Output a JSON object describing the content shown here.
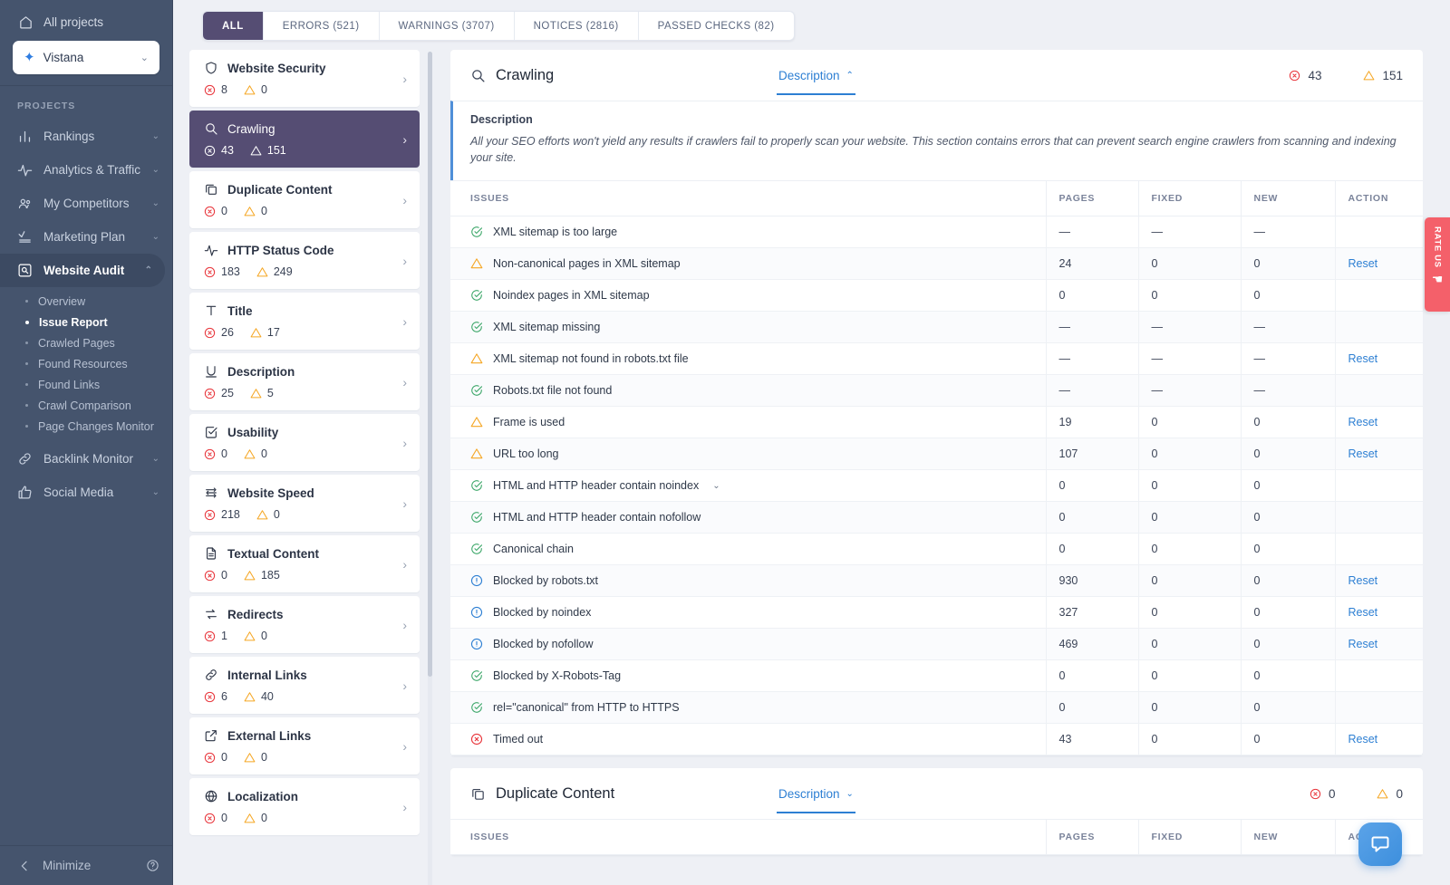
{
  "sidebar": {
    "all_projects": "All projects",
    "project_name": "Vistana",
    "section_label": "PROJECTS",
    "nav": [
      {
        "label": "Rankings",
        "icon": "bar-chart-icon",
        "expandable": true
      },
      {
        "label": "Analytics & Traffic",
        "icon": "pulse-icon",
        "expandable": true
      },
      {
        "label": "My Competitors",
        "icon": "people-icon",
        "expandable": true
      },
      {
        "label": "Marketing Plan",
        "icon": "checklist-icon",
        "expandable": true
      },
      {
        "label": "Website Audit",
        "icon": "magnifier-box-icon",
        "expandable": true,
        "active": true
      },
      {
        "label": "Backlink Monitor",
        "icon": "link-icon",
        "expandable": true
      },
      {
        "label": "Social Media",
        "icon": "thumbs-up-icon",
        "expandable": true
      }
    ],
    "audit_subnav": [
      {
        "label": "Overview"
      },
      {
        "label": "Issue Report",
        "current": true
      },
      {
        "label": "Crawled Pages"
      },
      {
        "label": "Found Resources"
      },
      {
        "label": "Found Links"
      },
      {
        "label": "Crawl Comparison"
      },
      {
        "label": "Page Changes Monitor"
      }
    ],
    "minimize": "Minimize"
  },
  "tabs": [
    {
      "label": "ALL",
      "active": true
    },
    {
      "label": "ERRORS (521)",
      "active": false
    },
    {
      "label": "WARNINGS (3707)",
      "active": false
    },
    {
      "label": "NOTICES (2816)",
      "active": false
    },
    {
      "label": "PASSED CHECKS (82)",
      "active": false
    }
  ],
  "categories": [
    {
      "name": "Website Security",
      "icon": "shield-icon",
      "errors": "8",
      "warnings": "0",
      "selected": false
    },
    {
      "name": "Crawling",
      "icon": "magnifier-icon",
      "errors": "43",
      "warnings": "151",
      "selected": true
    },
    {
      "name": "Duplicate Content",
      "icon": "copy-icon",
      "errors": "0",
      "warnings": "0",
      "selected": false
    },
    {
      "name": "HTTP Status Code",
      "icon": "pulse-icon",
      "errors": "183",
      "warnings": "249",
      "selected": false
    },
    {
      "name": "Title",
      "icon": "letter-t-icon",
      "errors": "26",
      "warnings": "17",
      "selected": false
    },
    {
      "name": "Description",
      "icon": "letter-u-icon",
      "errors": "25",
      "warnings": "5",
      "selected": false
    },
    {
      "name": "Usability",
      "icon": "check-square-icon",
      "errors": "0",
      "warnings": "0",
      "selected": false
    },
    {
      "name": "Website Speed",
      "icon": "speed-icon",
      "errors": "218",
      "warnings": "0",
      "selected": false
    },
    {
      "name": "Textual Content",
      "icon": "document-icon",
      "errors": "0",
      "warnings": "185",
      "selected": false
    },
    {
      "name": "Redirects",
      "icon": "redirect-icon",
      "errors": "1",
      "warnings": "0",
      "selected": false
    },
    {
      "name": "Internal Links",
      "icon": "link-icon",
      "errors": "6",
      "warnings": "40",
      "selected": false
    },
    {
      "name": "External Links",
      "icon": "external-link-icon",
      "errors": "0",
      "warnings": "0",
      "selected": false
    },
    {
      "name": "Localization",
      "icon": "globe-icon",
      "errors": "0",
      "warnings": "0",
      "selected": false
    }
  ],
  "panels": [
    {
      "title": "Crawling",
      "icon": "magnifier-icon",
      "description_toggle": "Description",
      "description_open": true,
      "errors": "43",
      "warnings": "151",
      "description_label": "Description",
      "description_text": "All your SEO efforts won't yield any results if crawlers fail to properly scan your website. This section contains errors that can prevent search engine crawlers from scanning and indexing your site.",
      "columns": [
        "ISSUES",
        "PAGES",
        "FIXED",
        "NEW",
        "ACTION"
      ],
      "rows": [
        {
          "status": "ok",
          "issue": "XML sitemap is too large",
          "pages": "—",
          "fixed": "—",
          "new": "—",
          "action": ""
        },
        {
          "status": "warn",
          "issue": "Non-canonical pages in XML sitemap",
          "pages": "24",
          "fixed": "0",
          "new": "0",
          "action": "Reset"
        },
        {
          "status": "ok",
          "issue": "Noindex pages in XML sitemap",
          "pages": "0",
          "fixed": "0",
          "new": "0",
          "action": ""
        },
        {
          "status": "ok",
          "issue": "XML sitemap missing",
          "pages": "—",
          "fixed": "—",
          "new": "—",
          "action": ""
        },
        {
          "status": "warn",
          "issue": "XML sitemap not found in robots.txt file",
          "pages": "—",
          "fixed": "—",
          "new": "—",
          "action": "Reset"
        },
        {
          "status": "ok",
          "issue": "Robots.txt file not found",
          "pages": "—",
          "fixed": "—",
          "new": "—",
          "action": ""
        },
        {
          "status": "warn",
          "issue": "Frame is used",
          "pages": "19",
          "fixed": "0",
          "new": "0",
          "action": "Reset"
        },
        {
          "status": "warn",
          "issue": "URL too long",
          "pages": "107",
          "fixed": "0",
          "new": "0",
          "action": "Reset"
        },
        {
          "status": "ok",
          "issue": "HTML and HTTP header contain noindex",
          "pages": "0",
          "fixed": "0",
          "new": "0",
          "action": "",
          "expandable": true
        },
        {
          "status": "ok",
          "issue": "HTML and HTTP header contain nofollow",
          "pages": "0",
          "fixed": "0",
          "new": "0",
          "action": ""
        },
        {
          "status": "ok",
          "issue": "Canonical chain",
          "pages": "0",
          "fixed": "0",
          "new": "0",
          "action": ""
        },
        {
          "status": "info",
          "issue": "Blocked by robots.txt",
          "pages": "930",
          "fixed": "0",
          "new": "0",
          "action": "Reset"
        },
        {
          "status": "info",
          "issue": "Blocked by noindex",
          "pages": "327",
          "fixed": "0",
          "new": "0",
          "action": "Reset"
        },
        {
          "status": "info",
          "issue": "Blocked by nofollow",
          "pages": "469",
          "fixed": "0",
          "new": "0",
          "action": "Reset"
        },
        {
          "status": "ok",
          "issue": "Blocked by X-Robots-Tag",
          "pages": "0",
          "fixed": "0",
          "new": "0",
          "action": ""
        },
        {
          "status": "ok",
          "issue": "rel=\"canonical\" from HTTP to HTTPS",
          "pages": "0",
          "fixed": "0",
          "new": "0",
          "action": ""
        },
        {
          "status": "err",
          "issue": "Timed out",
          "pages": "43",
          "fixed": "0",
          "new": "0",
          "action": "Reset"
        }
      ]
    },
    {
      "title": "Duplicate Content",
      "icon": "copy-icon",
      "description_toggle": "Description",
      "description_open": false,
      "errors": "0",
      "warnings": "0",
      "columns": [
        "ISSUES",
        "PAGES",
        "FIXED",
        "NEW",
        "ACTION"
      ],
      "rows": []
    }
  ],
  "rate_us": {
    "label": "RATE US",
    "icon": "pointing-hand-icon"
  },
  "chat": {
    "icon": "chat-bubble-icon"
  },
  "colors": {
    "sidebar_bg": "#45546d",
    "accent_purple": "#554d73",
    "link_blue": "#2d7fd3",
    "error_red": "#e8343a",
    "warning_orange": "#f5a623",
    "ok_green": "#3fa86b",
    "rate_us_red": "#f4606a"
  }
}
